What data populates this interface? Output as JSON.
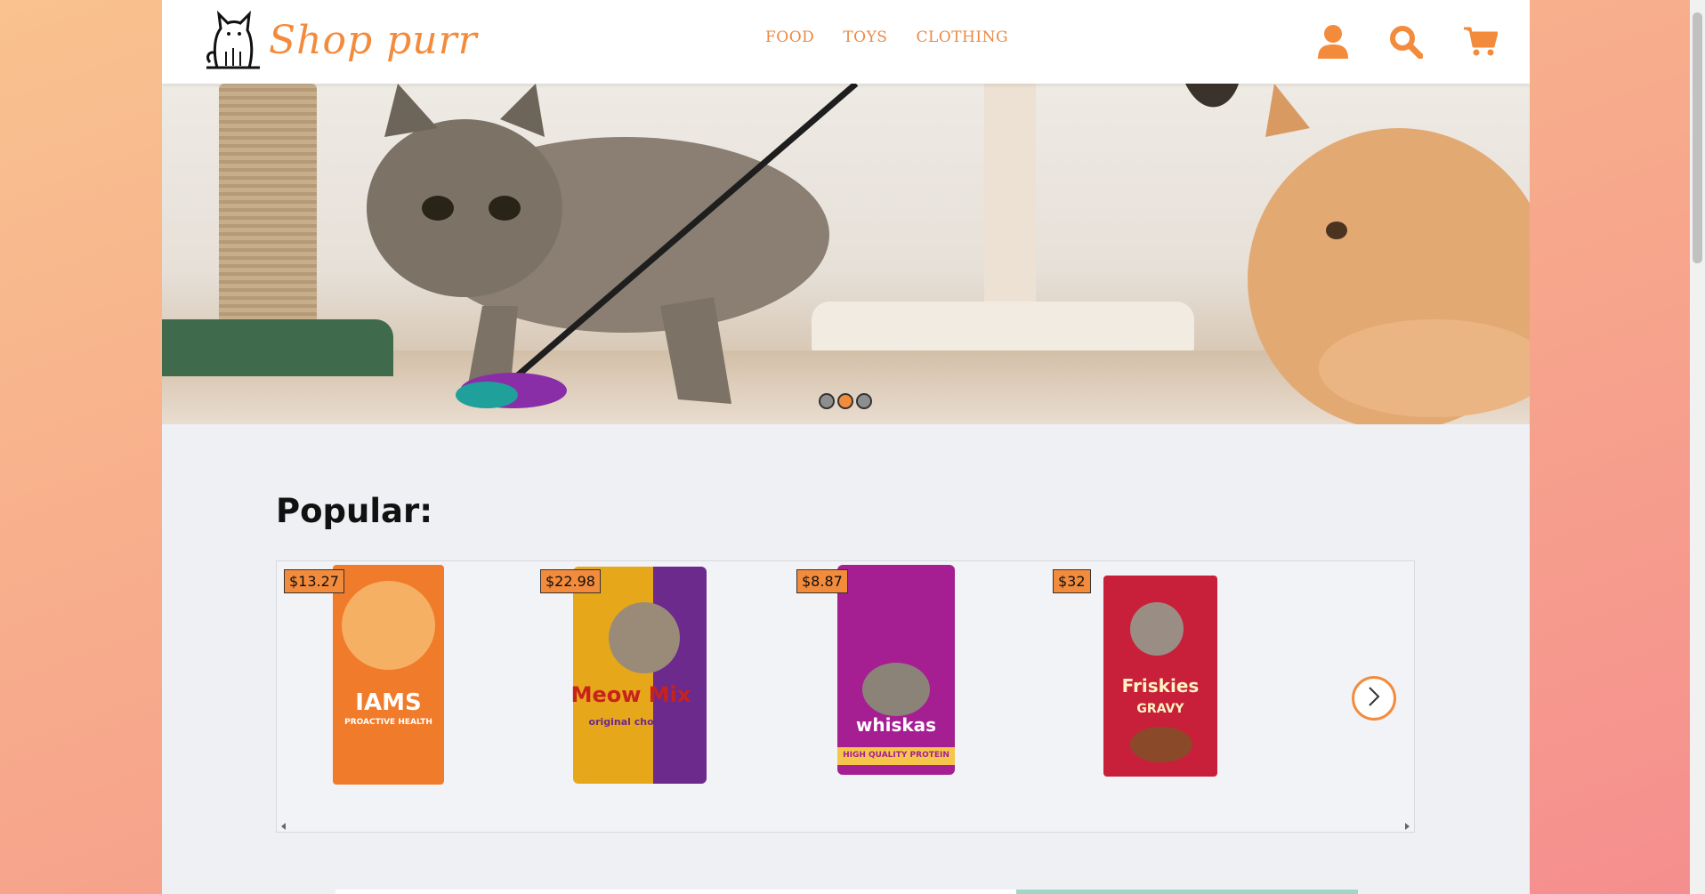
{
  "brand": {
    "name": "Shop purr",
    "accent": "#f38b3c"
  },
  "nav": [
    {
      "label": "FOOD"
    },
    {
      "label": "TOYS"
    },
    {
      "label": "CLOTHING"
    }
  ],
  "header_icons": [
    "user-icon",
    "search-icon",
    "cart-icon"
  ],
  "hero": {
    "slides": 3,
    "active_slide": 2
  },
  "popular": {
    "title": "Popular:",
    "products": [
      {
        "price": "$13.27",
        "brand": "IAMS",
        "bag_text": "PROACTIVE HEALTH",
        "color": "#f07b2a"
      },
      {
        "price": "$22.98",
        "brand": "Meow Mix",
        "bag_text": "original choice",
        "color": "#e7a71a"
      },
      {
        "price": "$8.87",
        "brand": "whiskas",
        "bag_text": "HIGH QUALITY PROTEIN",
        "color": "#a51f93"
      },
      {
        "price": "$32",
        "brand": "Friskies",
        "bag_text": "GRAVY",
        "color": "#c8203a"
      }
    ]
  }
}
